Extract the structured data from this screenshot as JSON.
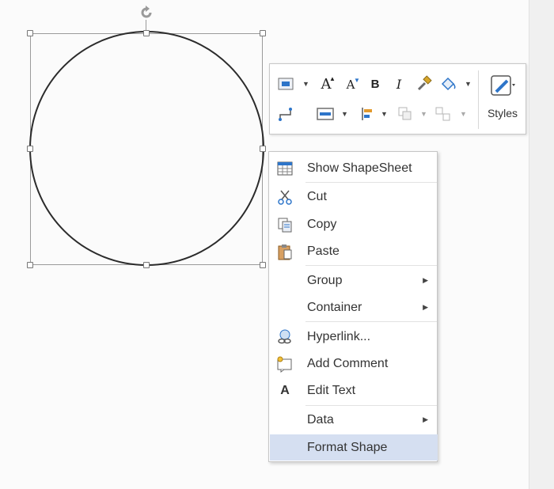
{
  "toolbar": {
    "styles_label": "Styles",
    "font_grow": "A",
    "font_shrink": "A",
    "bold": "B",
    "italic": "I"
  },
  "context_menu": {
    "items": [
      {
        "label": "Show ShapeSheet",
        "icon": "shapesheet-icon"
      },
      {
        "label": "Cut",
        "icon": "scissors-icon"
      },
      {
        "label": "Copy",
        "icon": "copy-icon"
      },
      {
        "label": "Paste",
        "icon": "clipboard-icon"
      },
      {
        "label": "Group",
        "submenu": true
      },
      {
        "label": "Container",
        "submenu": true
      },
      {
        "label": "Hyperlink...",
        "icon": "hyperlink-icon"
      },
      {
        "label": "Add Comment",
        "icon": "comment-icon"
      },
      {
        "label": "Edit Text",
        "icon": "letter-a-icon",
        "glyph": "A"
      },
      {
        "label": "Data",
        "submenu": true
      },
      {
        "label": "Format Shape",
        "highlighted": true
      }
    ],
    "submenu_arrow": "▶"
  },
  "colors": {
    "highlight": "#d5dff1",
    "accent_blue": "#2e75c9",
    "shape_stroke": "#2b2b2b"
  }
}
